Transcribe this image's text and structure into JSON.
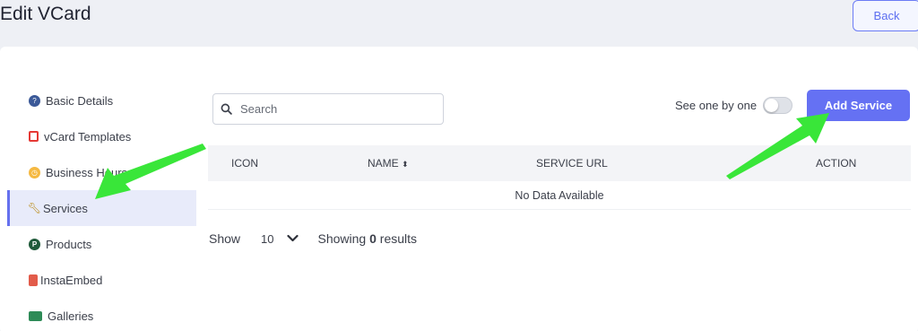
{
  "header": {
    "title": "Edit VCard",
    "back_label": "Back"
  },
  "sidebar": {
    "items": [
      {
        "label": "Basic Details",
        "icon": "question-circle-icon",
        "color": "#3b5998"
      },
      {
        "label": "vCard Templates",
        "icon": "template-icon",
        "color": "#e53935"
      },
      {
        "label": "Business Hours",
        "icon": "clock-icon",
        "color": "#f5b942"
      },
      {
        "label": "Services",
        "icon": "wrench-icon",
        "color": "#b8860b",
        "active": true
      },
      {
        "label": "Products",
        "icon": "product-p-icon",
        "color": "#1f5a3a"
      },
      {
        "label": "InstaEmbed",
        "icon": "clipboard-icon",
        "color": "#e25b4a"
      },
      {
        "label": "Galleries",
        "icon": "image-gallery-icon",
        "color": "#2e8b57"
      }
    ]
  },
  "toolbar": {
    "search_placeholder": "Search",
    "toggle_label": "See one by one",
    "toggle_on": false,
    "add_label": "Add Service"
  },
  "table": {
    "columns": [
      "ICON",
      "NAME",
      "SERVICE URL",
      "ACTION"
    ],
    "empty_text": "No Data Available"
  },
  "pager": {
    "show_label": "Show",
    "page_size": "10",
    "showing_prefix": "Showing",
    "count": "0",
    "showing_suffix": "results"
  },
  "colors": {
    "accent": "#6571f3",
    "annotation_arrow": "#39e639"
  }
}
